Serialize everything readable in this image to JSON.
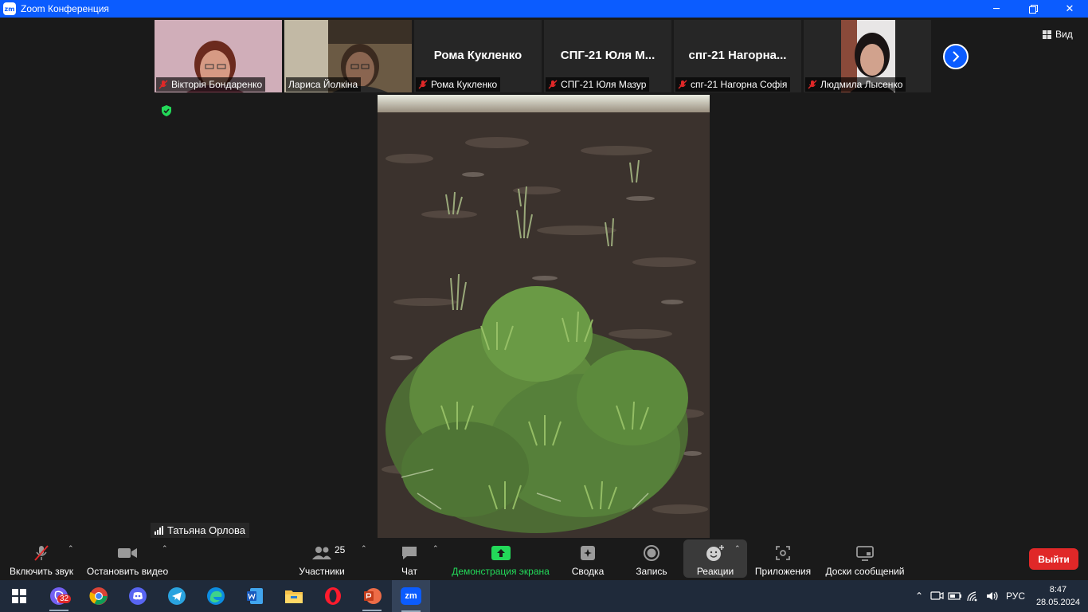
{
  "window": {
    "title": "Zoom Конференция",
    "logo": "zm",
    "controls": [
      "minimize-icon",
      "restore-icon",
      "close-icon"
    ]
  },
  "participants": [
    {
      "label": "Вікторія Бондаренко",
      "muted": true,
      "video": true
    },
    {
      "label": "Лариса Йолкіна",
      "muted": false,
      "video": true
    },
    {
      "label": "Рома Кукленко",
      "display": "Рома Кукленко",
      "muted": true,
      "video": false
    },
    {
      "label": "СПГ-21 Юля Мазур",
      "display": "СПГ-21 Юля М...",
      "muted": true,
      "video": false
    },
    {
      "label": "спг-21 Нагорна Софія",
      "display": "спг-21  Нагорна...",
      "muted": true,
      "video": false
    },
    {
      "label": "Людмила Лысенко",
      "muted": true,
      "video": true
    }
  ],
  "view_button": {
    "label": "Вид"
  },
  "active_speaker": {
    "name": "Татьяна Орлова"
  },
  "toolbar": {
    "mute": "Включить звук",
    "video": "Остановить видео",
    "participants": "Участники",
    "participants_count": "25",
    "chat": "Чат",
    "share": "Демонстрация экрана",
    "summary": "Сводка",
    "record": "Запись",
    "reactions": "Реакции",
    "apps": "Приложения",
    "whiteboards": "Доски сообщений",
    "leave": "Выйти"
  },
  "colors": {
    "zoom_blue": "#0b5cff",
    "mute_red": "#e02828",
    "share_green": "#23d959",
    "leave_red": "#e02828",
    "toolbar_bg": "#1a1a1a"
  },
  "taskbar": {
    "apps": [
      "windows-start-icon",
      "viber-icon",
      "chrome-icon",
      "discord-icon",
      "telegram-icon",
      "edge-icon",
      "word-icon",
      "file-explorer-icon",
      "opera-icon",
      "powerpoint-icon",
      "zoom-icon"
    ],
    "viber_badge": "32",
    "zoom_label": "zm",
    "language": "РУС",
    "time": "8:47",
    "date": "28.05.2024"
  }
}
